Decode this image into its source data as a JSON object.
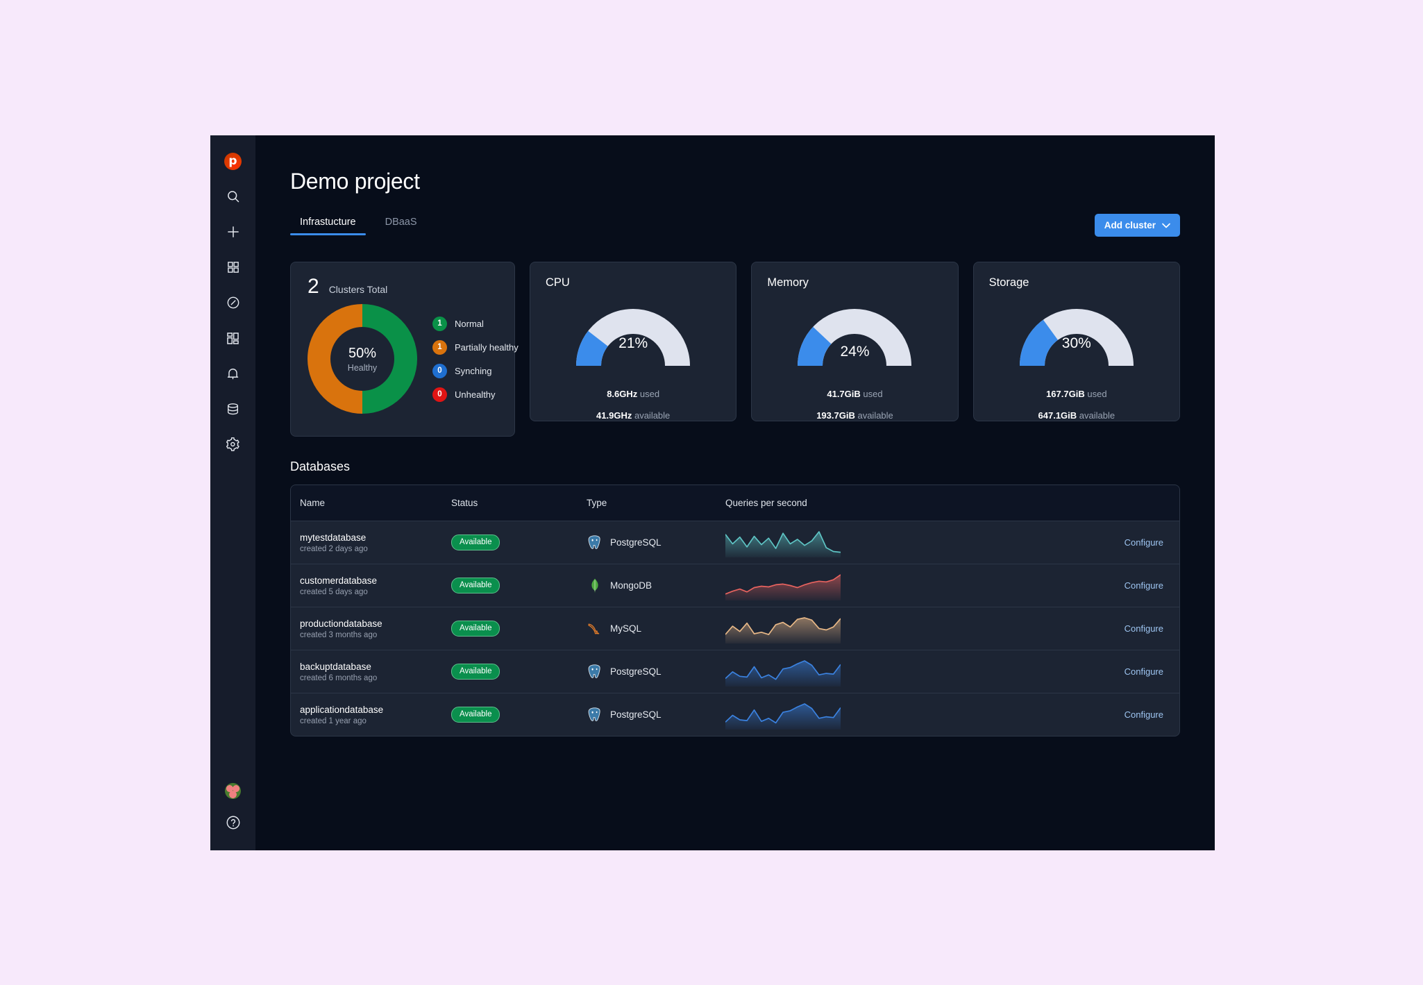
{
  "app": {
    "page_title": "Demo project",
    "accent_color": "#3b8ceb",
    "background_color": "#070d1a",
    "card_color": "#1c2433"
  },
  "sidebar": {
    "logo_letter": "p",
    "items": [
      {
        "name": "search-icon",
        "label": "Search"
      },
      {
        "name": "add-icon",
        "label": "Add"
      },
      {
        "name": "grid-icon",
        "label": "Grid"
      },
      {
        "name": "compass-icon",
        "label": "Explore"
      },
      {
        "name": "dashboard-icon",
        "label": "Dashboard"
      },
      {
        "name": "bell-icon",
        "label": "Notifications"
      },
      {
        "name": "database-icon",
        "label": "Databases"
      },
      {
        "name": "gear-icon",
        "label": "Settings"
      }
    ],
    "bottom": [
      {
        "name": "avatar",
        "label": "User avatar"
      },
      {
        "name": "help-icon",
        "label": "Help"
      }
    ]
  },
  "tabs": [
    {
      "label": "Infrastucture",
      "active": true
    },
    {
      "label": "DBaaS",
      "active": false
    }
  ],
  "toolbar": {
    "add_cluster_label": "Add cluster"
  },
  "clusters_card": {
    "count": "2",
    "count_label": "Clusters Total",
    "center_percent": "50%",
    "center_sub": "Healthy",
    "legend": [
      {
        "count": "1",
        "label": "Normal",
        "color": "#0a9148"
      },
      {
        "count": "1",
        "label": "Partially healthy",
        "color": "#d9730d"
      },
      {
        "count": "0",
        "label": "Synching",
        "color": "#1f6fd0"
      },
      {
        "count": "0",
        "label": "Unhealthy",
        "color": "#e01414"
      }
    ]
  },
  "gauges": [
    {
      "title": "CPU",
      "percent": "21%",
      "value": 21,
      "used_value": "8.6GHz",
      "used_label": "used",
      "available_value": "41.9GHz",
      "available_label": "available"
    },
    {
      "title": "Memory",
      "percent": "24%",
      "value": 24,
      "used_value": "41.7GiB",
      "used_label": "used",
      "available_value": "193.7GiB",
      "available_label": "available"
    },
    {
      "title": "Storage",
      "percent": "30%",
      "value": 30,
      "used_value": "167.7GiB",
      "used_label": "used",
      "available_value": "647.1GiB",
      "available_label": "available"
    }
  ],
  "databases_section": {
    "heading": "Databases",
    "columns": [
      "Name",
      "Status",
      "Type",
      "Queries per second",
      ""
    ],
    "action_label": "Configure",
    "rows": [
      {
        "name": "mytestdatabase",
        "created": "created 2 days ago",
        "status": "Available",
        "type": "PostgreSQL",
        "type_icon": "postgresql-icon",
        "spark_color": "#5ec4c4",
        "spark_points": [
          55,
          30,
          48,
          22,
          50,
          28,
          45,
          18,
          58,
          30,
          42,
          26,
          38,
          62,
          20,
          10,
          8
        ]
      },
      {
        "name": "customerdatabase",
        "created": "created 5 days ago",
        "status": "Available",
        "type": "MongoDB",
        "type_icon": "mongodb-icon",
        "spark_color": "#e8635f",
        "spark_points": [
          12,
          20,
          26,
          18,
          30,
          34,
          32,
          38,
          40,
          36,
          30,
          38,
          44,
          48,
          46,
          52,
          66
        ]
      },
      {
        "name": "productiondatabase",
        "created": "created 3 months ago",
        "status": "Available",
        "type": "MySQL",
        "type_icon": "mysql-icon",
        "spark_color": "#e8b887",
        "spark_points": [
          18,
          40,
          26,
          48,
          20,
          24,
          18,
          44,
          50,
          38,
          58,
          62,
          56,
          34,
          30,
          38,
          60
        ]
      },
      {
        "name": "backuptdatabase",
        "created": "created 6 months ago",
        "status": "Available",
        "type": "PostgreSQL",
        "type_icon": "postgresql-icon",
        "spark_color": "#3b82e0",
        "spark_points": [
          16,
          34,
          22,
          20,
          48,
          18,
          26,
          14,
          42,
          46,
          56,
          64,
          52,
          26,
          30,
          28,
          54
        ]
      },
      {
        "name": "applicationdatabase",
        "created": "created 1 year ago",
        "status": "Available",
        "type": "PostgreSQL",
        "type_icon": "postgresql-icon",
        "spark_color": "#3b82e0",
        "spark_points": [
          14,
          32,
          20,
          18,
          46,
          16,
          24,
          12,
          40,
          44,
          54,
          62,
          50,
          24,
          28,
          26,
          52
        ]
      }
    ]
  }
}
